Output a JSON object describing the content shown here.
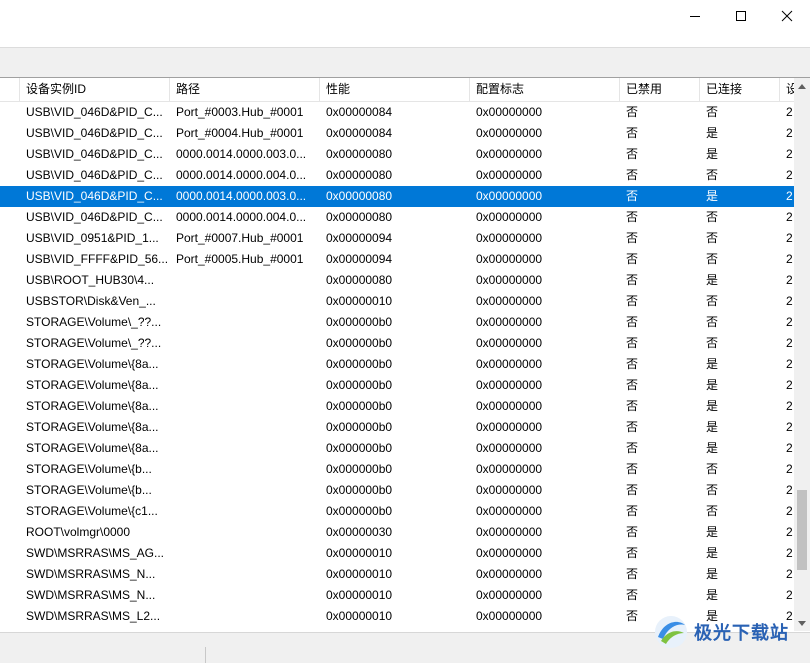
{
  "window": {
    "buttons": [
      "minimize-icon",
      "maximize-icon",
      "close-icon"
    ]
  },
  "colors": {
    "selection": "#0078d7",
    "header_border": "#e5e5e5"
  },
  "columns": [
    "设备实例ID",
    "路径",
    "性能",
    "配置标志",
    "已禁用",
    "已连接",
    "设"
  ],
  "selected_row_index": 4,
  "rows": [
    [
      "USB\\VID_046D&PID_C...",
      "Port_#0003.Hub_#0001",
      "0x00000084",
      "0x00000000",
      "否",
      "否",
      "2"
    ],
    [
      "USB\\VID_046D&PID_C...",
      "Port_#0004.Hub_#0001",
      "0x00000084",
      "0x00000000",
      "否",
      "是",
      "2"
    ],
    [
      "USB\\VID_046D&PID_C...",
      "0000.0014.0000.003.0...",
      "0x00000080",
      "0x00000000",
      "否",
      "是",
      "2"
    ],
    [
      "USB\\VID_046D&PID_C...",
      "0000.0014.0000.004.0...",
      "0x00000080",
      "0x00000000",
      "否",
      "否",
      "2"
    ],
    [
      "USB\\VID_046D&PID_C...",
      "0000.0014.0000.003.0...",
      "0x00000080",
      "0x00000000",
      "否",
      "是",
      "2"
    ],
    [
      "USB\\VID_046D&PID_C...",
      "0000.0014.0000.004.0...",
      "0x00000080",
      "0x00000000",
      "否",
      "否",
      "2"
    ],
    [
      "USB\\VID_0951&PID_1...",
      "Port_#0007.Hub_#0001",
      "0x00000094",
      "0x00000000",
      "否",
      "否",
      "2"
    ],
    [
      "USB\\VID_FFFF&PID_56...",
      "Port_#0005.Hub_#0001",
      "0x00000094",
      "0x00000000",
      "否",
      "否",
      "2"
    ],
    [
      "USB\\ROOT_HUB30\\4...",
      "",
      "0x00000080",
      "0x00000000",
      "否",
      "是",
      "2"
    ],
    [
      "USBSTOR\\Disk&Ven_...",
      "",
      "0x00000010",
      "0x00000000",
      "否",
      "否",
      "2"
    ],
    [
      "STORAGE\\Volume\\_??...",
      "",
      "0x000000b0",
      "0x00000000",
      "否",
      "否",
      "2"
    ],
    [
      "STORAGE\\Volume\\_??...",
      "",
      "0x000000b0",
      "0x00000000",
      "否",
      "否",
      "2"
    ],
    [
      "STORAGE\\Volume\\{8a...",
      "",
      "0x000000b0",
      "0x00000000",
      "否",
      "是",
      "2"
    ],
    [
      "STORAGE\\Volume\\{8a...",
      "",
      "0x000000b0",
      "0x00000000",
      "否",
      "是",
      "2"
    ],
    [
      "STORAGE\\Volume\\{8a...",
      "",
      "0x000000b0",
      "0x00000000",
      "否",
      "是",
      "2"
    ],
    [
      "STORAGE\\Volume\\{8a...",
      "",
      "0x000000b0",
      "0x00000000",
      "否",
      "是",
      "2"
    ],
    [
      "STORAGE\\Volume\\{8a...",
      "",
      "0x000000b0",
      "0x00000000",
      "否",
      "是",
      "2"
    ],
    [
      "STORAGE\\Volume\\{b...",
      "",
      "0x000000b0",
      "0x00000000",
      "否",
      "否",
      "2"
    ],
    [
      "STORAGE\\Volume\\{b...",
      "",
      "0x000000b0",
      "0x00000000",
      "否",
      "否",
      "2"
    ],
    [
      "STORAGE\\Volume\\{c1...",
      "",
      "0x000000b0",
      "0x00000000",
      "否",
      "否",
      "2"
    ],
    [
      "ROOT\\volmgr\\0000",
      "",
      "0x00000030",
      "0x00000000",
      "否",
      "是",
      "2"
    ],
    [
      "SWD\\MSRRAS\\MS_AG...",
      "",
      "0x00000010",
      "0x00000000",
      "否",
      "是",
      "2"
    ],
    [
      "SWD\\MSRRAS\\MS_N...",
      "",
      "0x00000010",
      "0x00000000",
      "否",
      "是",
      "2"
    ],
    [
      "SWD\\MSRRAS\\MS_N...",
      "",
      "0x00000010",
      "0x00000000",
      "否",
      "是",
      "2"
    ],
    [
      "SWD\\MSRRAS\\MS_L2...",
      "",
      "0x00000010",
      "0x00000000",
      "否",
      "是",
      "2"
    ]
  ],
  "watermark": {
    "text": "极光下载站",
    "logo": "aurora-logo-icon"
  }
}
